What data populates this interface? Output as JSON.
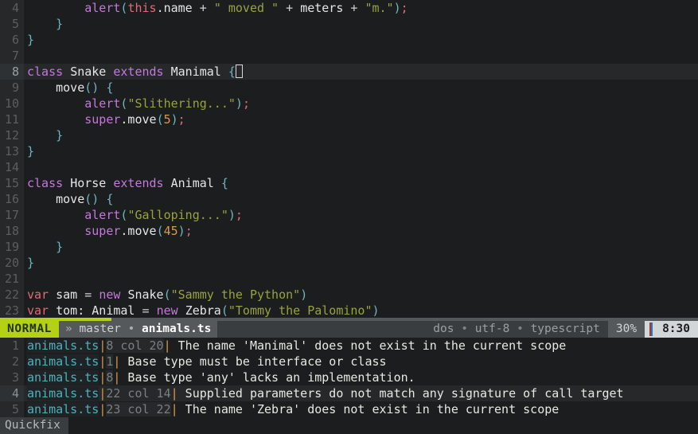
{
  "editor": {
    "first_visible_line": 4,
    "cursor_line": 8,
    "lines": [
      {
        "number": 4,
        "cursorline": false,
        "tokens": [
          {
            "t": "        ",
            "c": "plain"
          },
          {
            "t": "alert",
            "c": "kw"
          },
          {
            "t": "(",
            "c": "punct"
          },
          {
            "t": "this",
            "c": "kw2"
          },
          {
            "t": ".name ",
            "c": "id"
          },
          {
            "t": "+ ",
            "c": "op"
          },
          {
            "t": "\" moved \"",
            "c": "str"
          },
          {
            "t": " + ",
            "c": "op"
          },
          {
            "t": "meters ",
            "c": "id"
          },
          {
            "t": "+ ",
            "c": "op"
          },
          {
            "t": "\"m.\"",
            "c": "str"
          },
          {
            "t": ")",
            "c": "punct"
          },
          {
            "t": ";",
            "c": "semi"
          }
        ]
      },
      {
        "number": 5,
        "cursorline": false,
        "tokens": [
          {
            "t": "    ",
            "c": "plain"
          },
          {
            "t": "}",
            "c": "punct"
          }
        ]
      },
      {
        "number": 6,
        "cursorline": false,
        "tokens": [
          {
            "t": "}",
            "c": "punct"
          }
        ]
      },
      {
        "number": 7,
        "cursorline": false,
        "tokens": []
      },
      {
        "number": 8,
        "cursorline": true,
        "tokens": [
          {
            "t": "class ",
            "c": "kw"
          },
          {
            "t": "Snake ",
            "c": "id"
          },
          {
            "t": "extends ",
            "c": "kw"
          },
          {
            "t": "Manimal ",
            "c": "id"
          },
          {
            "t": "{",
            "c": "punct"
          },
          {
            "t": "\u0000CURSOR",
            "c": "cursor"
          }
        ]
      },
      {
        "number": 9,
        "cursorline": false,
        "tokens": [
          {
            "t": "    ",
            "c": "plain"
          },
          {
            "t": "move",
            "c": "id"
          },
          {
            "t": "() ",
            "c": "punct"
          },
          {
            "t": "{",
            "c": "punct"
          }
        ]
      },
      {
        "number": 10,
        "cursorline": false,
        "tokens": [
          {
            "t": "        ",
            "c": "plain"
          },
          {
            "t": "alert",
            "c": "kw"
          },
          {
            "t": "(",
            "c": "punct"
          },
          {
            "t": "\"Slithering...\"",
            "c": "str"
          },
          {
            "t": ")",
            "c": "punct"
          },
          {
            "t": ";",
            "c": "semi"
          }
        ]
      },
      {
        "number": 11,
        "cursorline": false,
        "tokens": [
          {
            "t": "        ",
            "c": "plain"
          },
          {
            "t": "super",
            "c": "kw"
          },
          {
            "t": ".move",
            "c": "id"
          },
          {
            "t": "(",
            "c": "punct"
          },
          {
            "t": "5",
            "c": "num"
          },
          {
            "t": ")",
            "c": "punct"
          },
          {
            "t": ";",
            "c": "semi"
          }
        ]
      },
      {
        "number": 12,
        "cursorline": false,
        "tokens": [
          {
            "t": "    ",
            "c": "plain"
          },
          {
            "t": "}",
            "c": "punct"
          }
        ]
      },
      {
        "number": 13,
        "cursorline": false,
        "tokens": [
          {
            "t": "}",
            "c": "punct"
          }
        ]
      },
      {
        "number": 14,
        "cursorline": false,
        "tokens": []
      },
      {
        "number": 15,
        "cursorline": false,
        "tokens": [
          {
            "t": "class ",
            "c": "kw"
          },
          {
            "t": "Horse ",
            "c": "id"
          },
          {
            "t": "extends ",
            "c": "kw"
          },
          {
            "t": "Animal ",
            "c": "id"
          },
          {
            "t": "{",
            "c": "punct"
          }
        ]
      },
      {
        "number": 16,
        "cursorline": false,
        "tokens": [
          {
            "t": "    ",
            "c": "plain"
          },
          {
            "t": "move",
            "c": "id"
          },
          {
            "t": "() ",
            "c": "punct"
          },
          {
            "t": "{",
            "c": "punct"
          }
        ]
      },
      {
        "number": 17,
        "cursorline": false,
        "tokens": [
          {
            "t": "        ",
            "c": "plain"
          },
          {
            "t": "alert",
            "c": "kw"
          },
          {
            "t": "(",
            "c": "punct"
          },
          {
            "t": "\"Galloping...\"",
            "c": "str"
          },
          {
            "t": ")",
            "c": "punct"
          },
          {
            "t": ";",
            "c": "semi"
          }
        ]
      },
      {
        "number": 18,
        "cursorline": false,
        "tokens": [
          {
            "t": "        ",
            "c": "plain"
          },
          {
            "t": "super",
            "c": "kw"
          },
          {
            "t": ".move",
            "c": "id"
          },
          {
            "t": "(",
            "c": "punct"
          },
          {
            "t": "45",
            "c": "num"
          },
          {
            "t": ")",
            "c": "punct"
          },
          {
            "t": ";",
            "c": "semi"
          }
        ]
      },
      {
        "number": 19,
        "cursorline": false,
        "tokens": [
          {
            "t": "    ",
            "c": "plain"
          },
          {
            "t": "}",
            "c": "punct"
          }
        ]
      },
      {
        "number": 20,
        "cursorline": false,
        "tokens": [
          {
            "t": "}",
            "c": "punct"
          }
        ]
      },
      {
        "number": 21,
        "cursorline": false,
        "tokens": []
      },
      {
        "number": 22,
        "cursorline": false,
        "tokens": [
          {
            "t": "var ",
            "c": "kw2"
          },
          {
            "t": "sam ",
            "c": "id"
          },
          {
            "t": "= ",
            "c": "op"
          },
          {
            "t": "new ",
            "c": "kw"
          },
          {
            "t": "Snake",
            "c": "id"
          },
          {
            "t": "(",
            "c": "punct"
          },
          {
            "t": "\"Sammy the Python\"",
            "c": "str"
          },
          {
            "t": ")",
            "c": "punct"
          }
        ]
      },
      {
        "number": 23,
        "cursorline": false,
        "tokens": [
          {
            "t": "var ",
            "c": "kw2"
          },
          {
            "t": "tom: ",
            "c": "id"
          },
          {
            "t": "Animal ",
            "c": "id"
          },
          {
            "t": "= ",
            "c": "op"
          },
          {
            "t": "new ",
            "c": "kw"
          },
          {
            "t": "Zebra",
            "c": "id"
          },
          {
            "t": "(",
            "c": "punct"
          },
          {
            "t": "\"Tommy the Palomino\"",
            "c": "str"
          },
          {
            "t": ")",
            "c": "punct"
          }
        ]
      }
    ]
  },
  "statusline": {
    "mode": "NORMAL",
    "branch_arrow": "»",
    "branch": "master",
    "separator_dot": "•",
    "filename": "animals.ts",
    "fileformat": "dos",
    "encoding": "utf-8",
    "filetype": "typescript",
    "percent": "30%",
    "position": "8:30",
    "position_line": "8",
    "position_col": "30"
  },
  "quickfix": {
    "title": "Quickfix",
    "selected_index": 3,
    "items": [
      {
        "index": "1",
        "file": "animals.ts",
        "loc": "8 col 20",
        "message": "The name 'Manimal' does not exist in the current scope"
      },
      {
        "index": "2",
        "file": "animals.ts",
        "loc": "1",
        "message": "Base type must be interface or class"
      },
      {
        "index": "3",
        "file": "animals.ts",
        "loc": "8",
        "message": "Base type 'any' lacks an implementation."
      },
      {
        "index": "4",
        "file": "animals.ts",
        "loc": "22 col 14",
        "message": "Supplied parameters do not match any signature of call target"
      },
      {
        "index": "5",
        "file": "animals.ts",
        "loc": "23 col 22",
        "message": "The name 'Zebra' does not exist in the current scope"
      }
    ]
  },
  "colors": {
    "background": "#1b1d1e",
    "gutter_bg": "#262829",
    "cursorline_bg": "#26282a",
    "mode_bg": "#b5d116",
    "mode_fg": "#20330a",
    "statusline_bg": "#3a3d3f",
    "keyword": "#c678dd",
    "string": "#9aa33c",
    "number": "#d99a4e",
    "punct": "#6fb6c1",
    "var_keyword": "#e06c75",
    "qf_file": "#4db2bf",
    "qf_bar": "#d99a4e"
  }
}
